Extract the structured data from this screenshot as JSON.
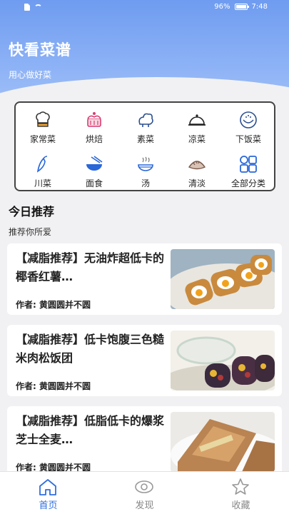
{
  "status_bar": {
    "battery_percent": "96%",
    "time": "7:48"
  },
  "header": {
    "title": "快看菜谱",
    "subtitle": "用心做好菜"
  },
  "categories": [
    {
      "label": "家常菜",
      "icon": "chef-hat-icon"
    },
    {
      "label": "烘焙",
      "icon": "cake-icon"
    },
    {
      "label": "素菜",
      "icon": "vegetable-icon"
    },
    {
      "label": "凉菜",
      "icon": "food-cover-icon"
    },
    {
      "label": "下饭菜",
      "icon": "rice-bowl-icon"
    },
    {
      "label": "川菜",
      "icon": "chili-pepper-icon"
    },
    {
      "label": "面食",
      "icon": "noodle-bowl-icon"
    },
    {
      "label": "汤",
      "icon": "soup-bowl-icon"
    },
    {
      "label": "清淡",
      "icon": "dumpling-icon"
    },
    {
      "label": "全部分类",
      "icon": "grid-icon"
    }
  ],
  "recommend": {
    "title": "今日推荐",
    "subtitle": "推荐你所爱",
    "items": [
      {
        "title": "【减脂推荐】无油炸超低卡的椰香红薯…",
        "author": "作者: 黄圆圆并不圆",
        "image": "egg-toast-photo"
      },
      {
        "title": "【减脂推荐】低卡饱腹三色糙米肉松饭团",
        "author": "作者: 黄圆圆并不圆",
        "image": "rice-roll-photo"
      },
      {
        "title": "【减脂推荐】低脂低卡的爆浆芝士全麦…",
        "author": "作者: 黄圆圆并不圆",
        "image": "wrap-photo"
      }
    ]
  },
  "tabs": [
    {
      "label": "首页",
      "icon": "home-icon",
      "active": true
    },
    {
      "label": "发现",
      "icon": "eye-icon",
      "active": false
    },
    {
      "label": "收藏",
      "icon": "star-icon",
      "active": false
    }
  ],
  "colors": {
    "accent": "#2f6fe0",
    "header_gradient_top": "#6f9cf0",
    "tab_inactive": "#888888",
    "icon_blue": "#2a67d8"
  }
}
